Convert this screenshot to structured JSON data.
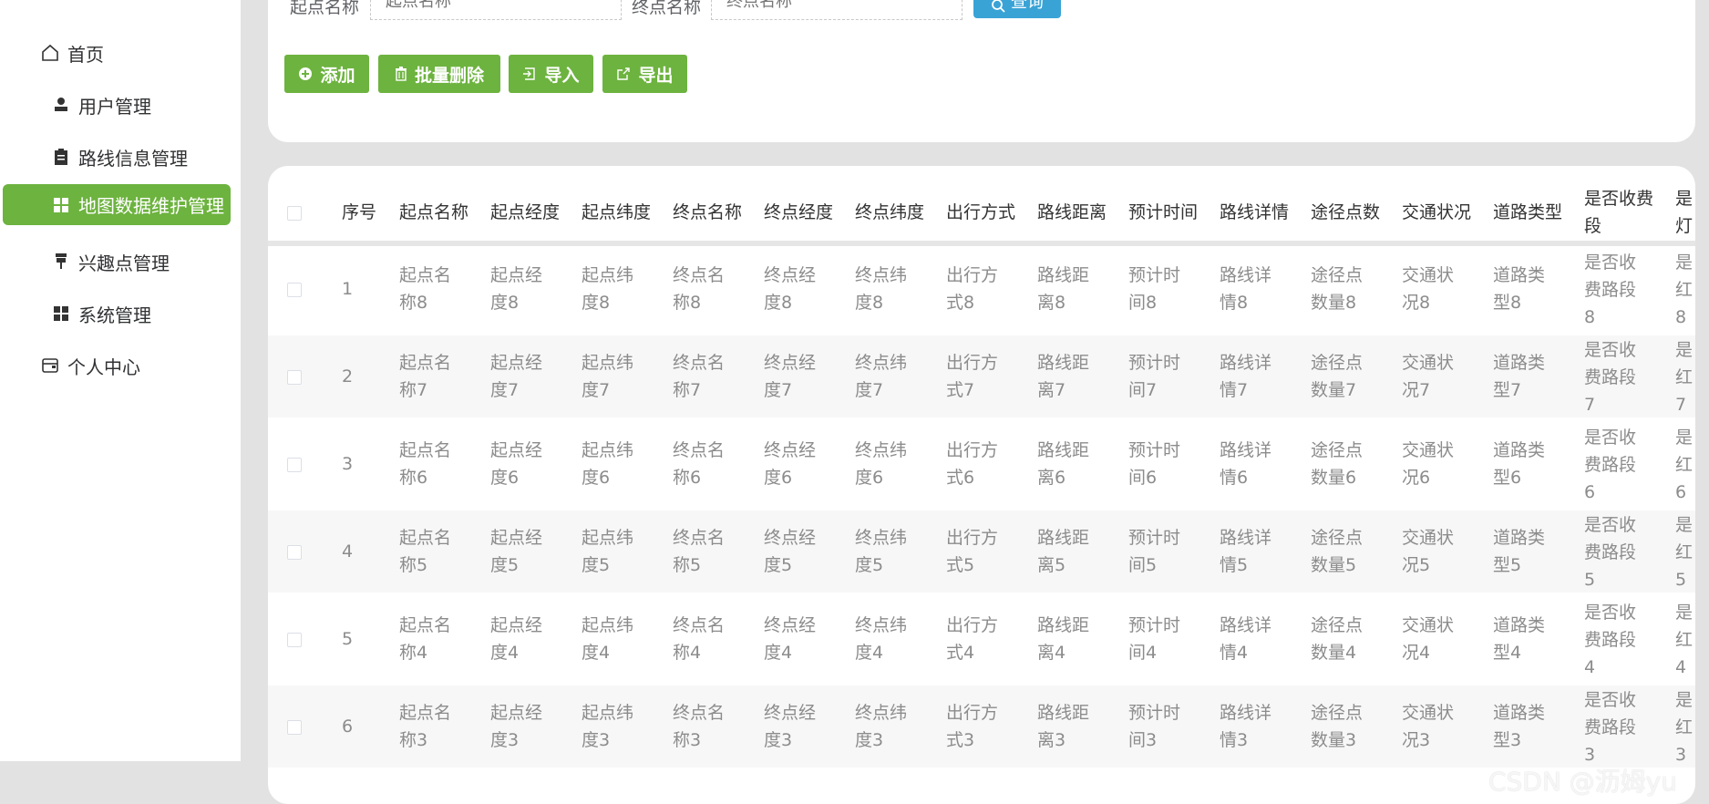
{
  "sidebar": {
    "items": [
      {
        "label": "首页",
        "icon": "home-icon"
      },
      {
        "label": "用户管理",
        "icon": "user-icon"
      },
      {
        "label": "路线信息管理",
        "icon": "clipboard-icon"
      },
      {
        "label": "地图数据维护管理",
        "icon": "grid-icon",
        "active": true
      },
      {
        "label": "兴趣点管理",
        "icon": "pin-icon"
      },
      {
        "label": "系统管理",
        "icon": "grid-icon"
      },
      {
        "label": "个人中心",
        "icon": "wallet-icon"
      }
    ]
  },
  "search": {
    "start_label": "起点名称",
    "start_placeholder": "起点名称",
    "end_label": "终点名称",
    "end_placeholder": "终点名称",
    "query_label": "查询"
  },
  "toolbar": {
    "add_label": "添加",
    "batch_delete_label": "批量删除",
    "import_label": "导入",
    "export_label": "导出"
  },
  "table": {
    "headers": [
      "序号",
      "起点名称",
      "起点经度",
      "起点纬度",
      "终点名称",
      "终点经度",
      "终点纬度",
      "出行方式",
      "路线距离",
      "预计时间",
      "路线详情",
      "途径点数",
      "交通状况",
      "道路类型",
      "是否收费路段",
      "是否红绿灯"
    ],
    "header_wrapped": {
      "col14_line1": "是否收费",
      "col14_line2": "段",
      "col15_line1": "是",
      "col15_line2": "灯"
    },
    "rows": [
      {
        "no": "1",
        "c": [
          [
            "起点名",
            "称8"
          ],
          [
            "起点经",
            "度8"
          ],
          [
            "起点纬",
            "度8"
          ],
          [
            "终点名",
            "称8"
          ],
          [
            "终点经",
            "度8"
          ],
          [
            "终点纬",
            "度8"
          ],
          [
            "出行方",
            "式8"
          ],
          [
            "路线距",
            "离8"
          ],
          [
            "预计时",
            "间8"
          ],
          [
            "路线详",
            "情8"
          ],
          [
            "途径点",
            "数量8"
          ],
          [
            "交通状",
            "况8"
          ],
          [
            "道路类",
            "型8"
          ],
          [
            "是否收",
            "费路段",
            "8"
          ],
          [
            "是",
            "红",
            "8"
          ]
        ]
      },
      {
        "no": "2",
        "c": [
          [
            "起点名",
            "称7"
          ],
          [
            "起点经",
            "度7"
          ],
          [
            "起点纬",
            "度7"
          ],
          [
            "终点名",
            "称7"
          ],
          [
            "终点经",
            "度7"
          ],
          [
            "终点纬",
            "度7"
          ],
          [
            "出行方",
            "式7"
          ],
          [
            "路线距",
            "离7"
          ],
          [
            "预计时",
            "间7"
          ],
          [
            "路线详",
            "情7"
          ],
          [
            "途径点",
            "数量7"
          ],
          [
            "交通状",
            "况7"
          ],
          [
            "道路类",
            "型7"
          ],
          [
            "是否收",
            "费路段",
            "7"
          ],
          [
            "是",
            "红",
            "7"
          ]
        ]
      },
      {
        "no": "3",
        "c": [
          [
            "起点名",
            "称6"
          ],
          [
            "起点经",
            "度6"
          ],
          [
            "起点纬",
            "度6"
          ],
          [
            "终点名",
            "称6"
          ],
          [
            "终点经",
            "度6"
          ],
          [
            "终点纬",
            "度6"
          ],
          [
            "出行方",
            "式6"
          ],
          [
            "路线距",
            "离6"
          ],
          [
            "预计时",
            "间6"
          ],
          [
            "路线详",
            "情6"
          ],
          [
            "途径点",
            "数量6"
          ],
          [
            "交通状",
            "况6"
          ],
          [
            "道路类",
            "型6"
          ],
          [
            "是否收",
            "费路段",
            "6"
          ],
          [
            "是",
            "红",
            "6"
          ]
        ]
      },
      {
        "no": "4",
        "c": [
          [
            "起点名",
            "称5"
          ],
          [
            "起点经",
            "度5"
          ],
          [
            "起点纬",
            "度5"
          ],
          [
            "终点名",
            "称5"
          ],
          [
            "终点经",
            "度5"
          ],
          [
            "终点纬",
            "度5"
          ],
          [
            "出行方",
            "式5"
          ],
          [
            "路线距",
            "离5"
          ],
          [
            "预计时",
            "间5"
          ],
          [
            "路线详",
            "情5"
          ],
          [
            "途径点",
            "数量5"
          ],
          [
            "交通状",
            "况5"
          ],
          [
            "道路类",
            "型5"
          ],
          [
            "是否收",
            "费路段",
            "5"
          ],
          [
            "是",
            "红",
            "5"
          ]
        ]
      },
      {
        "no": "5",
        "c": [
          [
            "起点名",
            "称4"
          ],
          [
            "起点经",
            "度4"
          ],
          [
            "起点纬",
            "度4"
          ],
          [
            "终点名",
            "称4"
          ],
          [
            "终点经",
            "度4"
          ],
          [
            "终点纬",
            "度4"
          ],
          [
            "出行方",
            "式4"
          ],
          [
            "路线距",
            "离4"
          ],
          [
            "预计时",
            "间4"
          ],
          [
            "路线详",
            "情4"
          ],
          [
            "途径点",
            "数量4"
          ],
          [
            "交通状",
            "况4"
          ],
          [
            "道路类",
            "型4"
          ],
          [
            "是否收",
            "费路段",
            "4"
          ],
          [
            "是",
            "红",
            "4"
          ]
        ]
      },
      {
        "no": "6",
        "c": [
          [
            "起点名",
            "称3"
          ],
          [
            "起点经",
            "度3"
          ],
          [
            "起点纬",
            "度3"
          ],
          [
            "终点名",
            "称3"
          ],
          [
            "终点经",
            "度3"
          ],
          [
            "终点纬",
            "度3"
          ],
          [
            "出行方",
            "式3"
          ],
          [
            "路线距",
            "离3"
          ],
          [
            "预计时",
            "间3"
          ],
          [
            "路线详",
            "情3"
          ],
          [
            "途径点",
            "数量3"
          ],
          [
            "交通状",
            "况3"
          ],
          [
            "道路类",
            "型3"
          ],
          [
            "是否收",
            "费路段",
            "3"
          ],
          [
            "是",
            "红",
            "3"
          ]
        ]
      }
    ]
  },
  "watermark": "CSDN @沥姆yu",
  "colors": {
    "accent": "#6db33f",
    "query": "#3aa3d6"
  }
}
